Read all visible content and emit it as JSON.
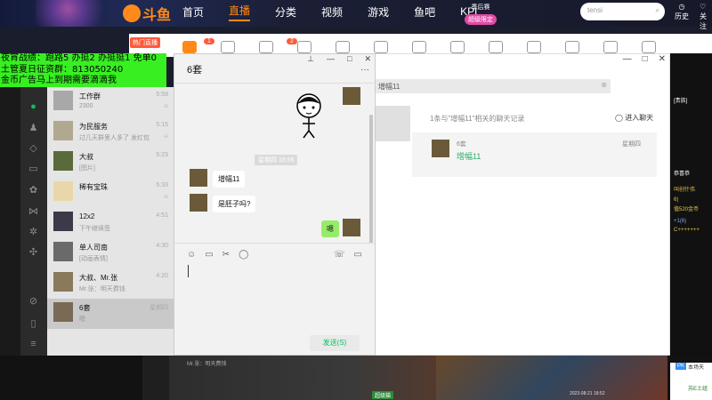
{
  "douyu": {
    "nav": [
      "首页",
      "直播",
      "分类",
      "视频",
      "游戏",
      "鱼吧",
      "KPL"
    ],
    "nav_dropdown": "•",
    "promo_line1": "季后赛",
    "promo_line2": "超级限定",
    "search_value": "tensi",
    "history_label": "历史",
    "follow_label": "关注",
    "cat_label": "热门直播",
    "cat_badge_1": "1",
    "cat_badge_2": "2"
  },
  "overlay": {
    "line1": "夜宵战绩：跑路5 办挺2 办挺挺1  免单0",
    "line2": "土管夏日征资群：813050240",
    "line3": "金币广告马上到期需要滴滴我"
  },
  "search_window": {
    "query": "增幅11",
    "related_title": "1条与\"增幅11\"相关的聊天记录",
    "enter_chat": "进入聊天",
    "result_name": "6套",
    "result_msg": "增幅11",
    "result_date": "星期四"
  },
  "conversations": [
    {
      "name": "工作群",
      "preview": "2300",
      "time": "5:59"
    },
    {
      "name": "为民服务",
      "preview": "过几天群里人多了 发红包",
      "time": "5:15"
    },
    {
      "name": "大叔",
      "preview": "[图片]",
      "time": "5:23"
    },
    {
      "name": "稀有宝珠",
      "preview": "",
      "time": "5:33"
    },
    {
      "name": "12x2",
      "preview": "下午继续签",
      "time": "4:51"
    },
    {
      "name": "单人司南",
      "preview": "[动画表情]",
      "time": "4:30"
    },
    {
      "name": "大叔、Mr.张",
      "preview": "Mr.张：明天费钱",
      "time": "4:20"
    },
    {
      "name": "6套",
      "preview": "嗯",
      "time": "星期四"
    }
  ],
  "chat": {
    "title": "6套",
    "timestamp": "星期四 16:56",
    "msg1": "增幅11",
    "msg2": "是胚子吗?",
    "msg3": "嗯",
    "send_label": "发送(S)",
    "more": "···"
  },
  "window_controls": {
    "pin": "⊥",
    "min": "—",
    "max": "□",
    "close": "✕"
  },
  "right_chat": [
    "[贵族]",
    "恭喜恭",
    "叫创什伟",
    "6)",
    "值520金币",
    "+1(6)",
    "C+++++++"
  ],
  "bottom": {
    "pk_badge": "PK",
    "pk_text": "本场天",
    "pk_text2": "苏E土组",
    "tag": "超级猫",
    "mr": "Mr.张：明天费钱",
    "timestamp": "2023-08-21 18:52"
  }
}
